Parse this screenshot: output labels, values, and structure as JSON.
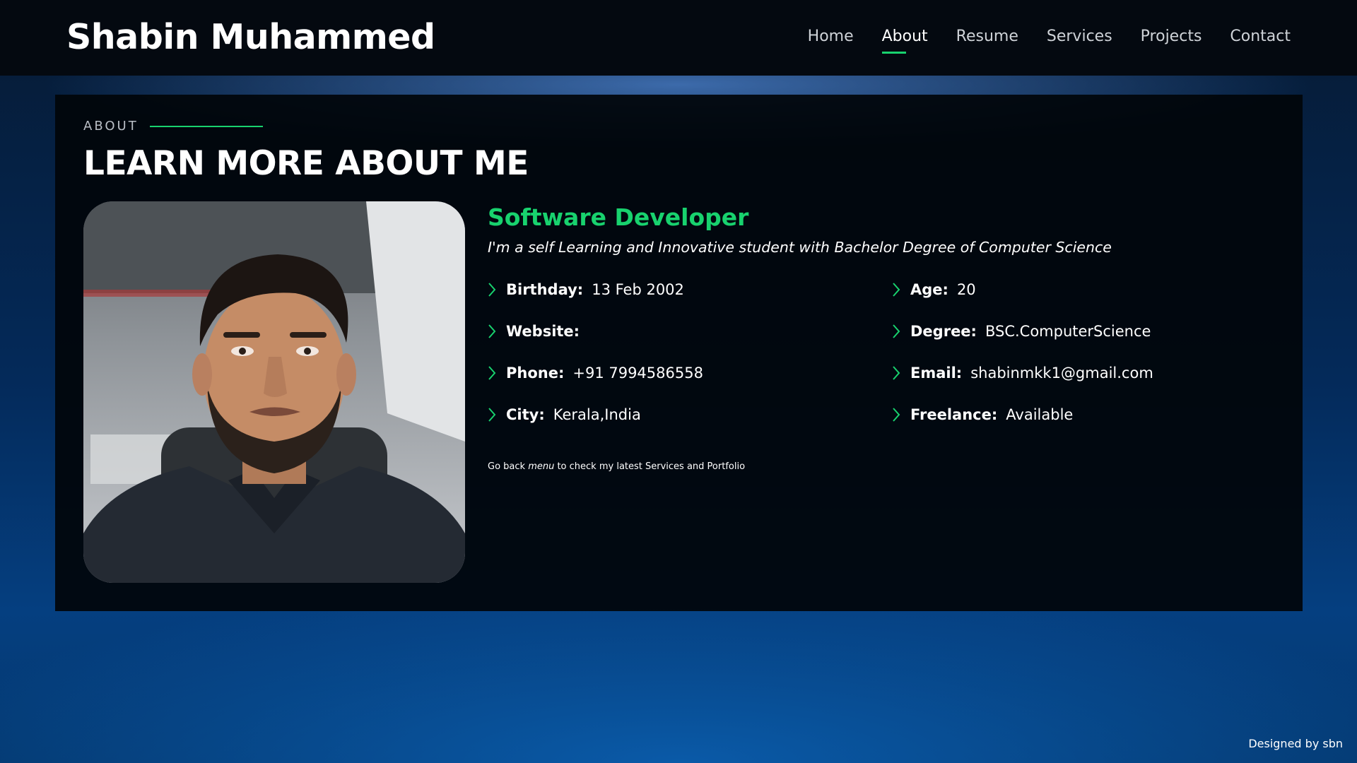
{
  "header": {
    "logo": "Shabin Muhammed",
    "nav": [
      {
        "label": "Home",
        "active": false
      },
      {
        "label": "About",
        "active": true
      },
      {
        "label": "Resume",
        "active": false
      },
      {
        "label": "Services",
        "active": false
      },
      {
        "label": "Projects",
        "active": false
      },
      {
        "label": "Contact",
        "active": false
      }
    ]
  },
  "about": {
    "section_label": "ABOUT",
    "title": "LEARN MORE ABOUT ME",
    "role": "Software Developer",
    "intro": "I'm a self Learning and Innovative student with Bachelor Degree of Computer Science",
    "details": [
      {
        "key": "Birthday:",
        "value": "13 Feb 2002"
      },
      {
        "key": "Age:",
        "value": "20"
      },
      {
        "key": "Website:",
        "value": ""
      },
      {
        "key": "Degree:",
        "value": "BSC.ComputerScience"
      },
      {
        "key": "Phone:",
        "value": "+91 7994586558"
      },
      {
        "key": "Email:",
        "value": "shabinmkk1@gmail.com"
      },
      {
        "key": "City:",
        "value": "Kerala,India"
      },
      {
        "key": "Freelance:",
        "value": "Available"
      }
    ],
    "note": {
      "before": "Go back ",
      "emphasis": "menu",
      "after": " to check my latest Services and Portfolio"
    }
  },
  "footer": {
    "credit": "Designed by sbn"
  },
  "colors": {
    "accent": "#18d26e",
    "header_bg": "#040910",
    "panel_bg": "#01050a"
  },
  "icons": {
    "detail_bullet": "chevron-right-icon"
  }
}
